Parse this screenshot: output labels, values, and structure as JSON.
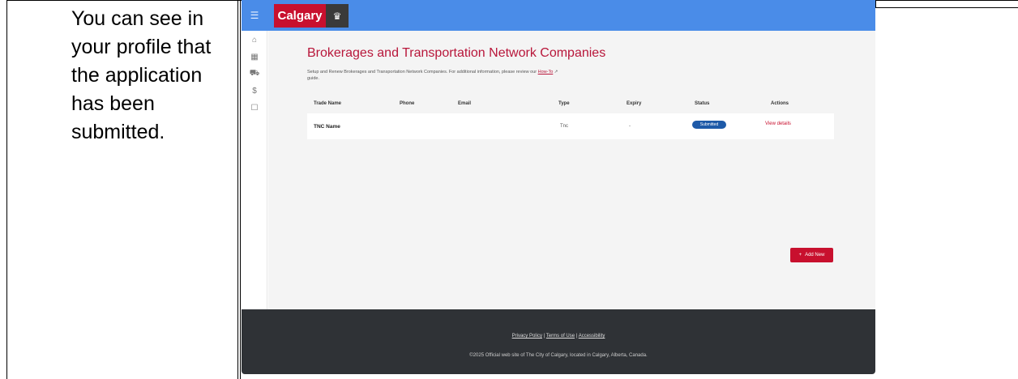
{
  "instruction": {
    "text": "You can see in your profile that the application has been submitted."
  },
  "app": {
    "logo_text": "Calgary",
    "page_title": "Brokerages and Transportation Network Companies",
    "description_prefix": "Setup and Renew Brokerages and Transportation Network Companies. For additional information, please review our ",
    "description_link": "How-To",
    "description_suffix": " guide.",
    "table": {
      "headers": [
        "Trade Name",
        "Phone",
        "Email",
        "Type",
        "Expiry",
        "Status",
        "Actions"
      ],
      "rows": [
        {
          "trade_name": "TNC Name",
          "phone": "",
          "email": "",
          "type": "Tnc",
          "expiry": "-",
          "status": "Submitted",
          "action": "View details"
        }
      ]
    },
    "add_button": "Add New",
    "footer": {
      "privacy": "Privacy Policy",
      "terms": "Terms of Use",
      "accessibility": "Accessibility",
      "copyright": "©2025 Official web site of The City of Calgary, located in Calgary, Alberta, Canada."
    },
    "colors": {
      "topbar": "#4a8ce8",
      "brand_red": "#c8102e",
      "status_badge": "#1e5aa8",
      "footer": "#2f3236"
    }
  }
}
